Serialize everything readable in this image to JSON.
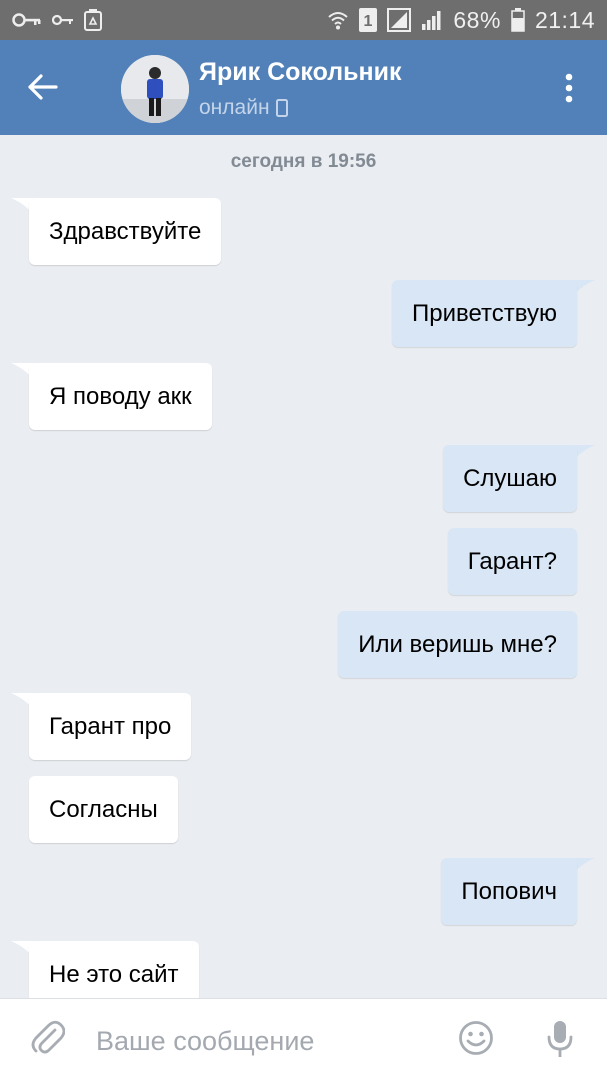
{
  "status_bar": {
    "battery": "68%",
    "time": "21:14",
    "sim_slot": "1",
    "icons_left": [
      "key-icon",
      "key-small-icon",
      "recycle-icon"
    ],
    "icons_right": [
      "wifi-icon",
      "sim1-icon",
      "signal-icon",
      "signal-icon",
      "battery-icon"
    ]
  },
  "header": {
    "contact_name": "Ярик Сокольник",
    "status": "онлайн",
    "status_icon": "mobile-phone-icon"
  },
  "chat": {
    "date_separator": "сегодня в 19:56",
    "messages": [
      {
        "direction": "in",
        "text": "Здравствуйте"
      },
      {
        "direction": "out",
        "text": "Приветствую"
      },
      {
        "direction": "in",
        "text": "Я поводу акк"
      },
      {
        "direction": "out",
        "text": "Слушаю"
      },
      {
        "direction": "out",
        "text": "Гарант?"
      },
      {
        "direction": "out",
        "text": "Или веришь мне?"
      },
      {
        "direction": "in",
        "text": "Гарант про"
      },
      {
        "direction": "in",
        "text": "Согласны"
      },
      {
        "direction": "out",
        "text": "Попович"
      },
      {
        "direction": "in",
        "text": "Не это сайт"
      }
    ]
  },
  "composer": {
    "placeholder": "Ваше сообщение",
    "value": ""
  },
  "colors": {
    "header_bg": "#5181b8",
    "chat_bg": "#eaedf1",
    "incoming_bubble": "#ffffff",
    "outgoing_bubble": "#d9e6f5"
  }
}
